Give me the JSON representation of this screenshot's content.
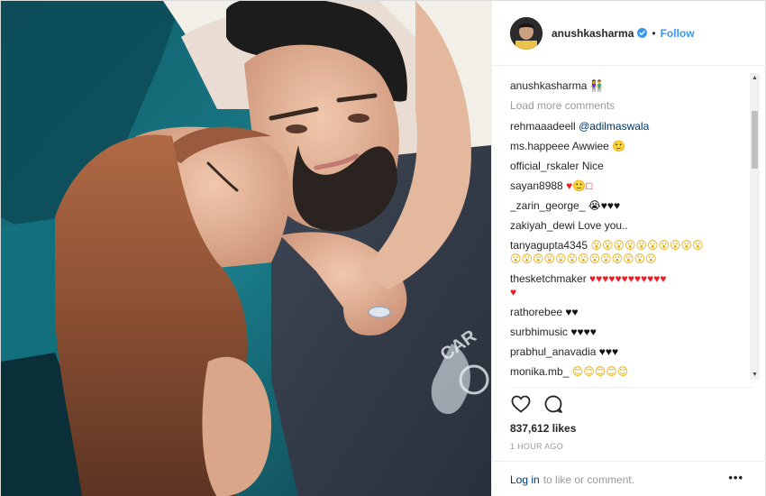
{
  "header": {
    "username": "anushkasharma",
    "separator": "•",
    "follow_label": "Follow"
  },
  "caption": {
    "username": "anushkasharma",
    "emoji": "👫"
  },
  "load_more": "Load more comments",
  "comments": [
    {
      "user": "rehmaaadeell",
      "text": "@adilmaswala",
      "type": "mention"
    },
    {
      "user": "ms.happeee",
      "text": "Awwiee 🙂",
      "type": "text"
    },
    {
      "user": "official_rskaler",
      "text": "Nice",
      "type": "text"
    },
    {
      "user": "sayan8988",
      "text": "♥🙂□",
      "type": "text"
    },
    {
      "user": "_zarin_george_",
      "text": "😭♥♥♥",
      "type": "text"
    },
    {
      "user": "zakiyah_dewi",
      "text": "Love you..",
      "type": "text"
    },
    {
      "user": "tanyagupta4345",
      "text": "😮😮😮😮😮😮😮😮😮😮",
      "type": "text"
    },
    {
      "user": "",
      "text": "😮😮😮😮😮😮😮😮😮😮😮😮😮",
      "type": "text"
    },
    {
      "user": "thesketchmaker",
      "text": "♥♥♥♥♥♥♥♥♥♥♥♥",
      "type": "hearts"
    },
    {
      "user": "",
      "text": "♥",
      "type": "hearts"
    },
    {
      "user": "rathorebee",
      "text": "♥♥",
      "type": "black"
    },
    {
      "user": "surbhimusic",
      "text": "♥♥♥♥",
      "type": "black"
    },
    {
      "user": "prabhul_anavadia",
      "text": "♥♥♥",
      "type": "black"
    },
    {
      "user": "monika.mb_",
      "text": "😊😊😊😊😊",
      "type": "text"
    }
  ],
  "actions": {
    "like_icon": "heart-outline-icon",
    "comment_icon": "comment-bubble-icon"
  },
  "likes": "837,612 likes",
  "time": "1 HOUR AGO",
  "footer": {
    "login_label": "Log in",
    "rest_text": "to like or comment.",
    "more_label": "•••"
  },
  "colors": {
    "link": "#3897f0",
    "mention": "#003569",
    "muted": "#999999",
    "heart": "#ed1c24"
  }
}
